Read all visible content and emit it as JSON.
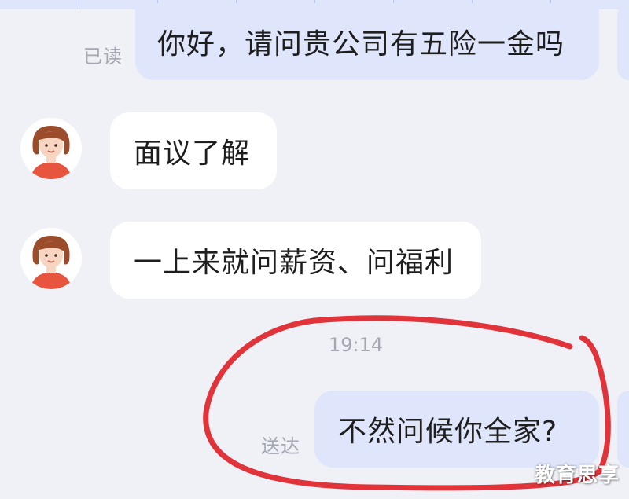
{
  "messages": [
    {
      "direction": "out",
      "status": "已读",
      "text": "你好，请问贵公司有五险一金吗"
    },
    {
      "direction": "in",
      "text": "面议了解"
    },
    {
      "direction": "in",
      "text": "一上来就问薪资、问福利"
    },
    {
      "direction": "out",
      "status": "送达",
      "text": "不然问候你全家?"
    }
  ],
  "timestamp": "19:14",
  "avatar_icon": "cartoon-woman-avatar-icon",
  "annotation_color": "#e0343a",
  "watermark": "教育思享"
}
